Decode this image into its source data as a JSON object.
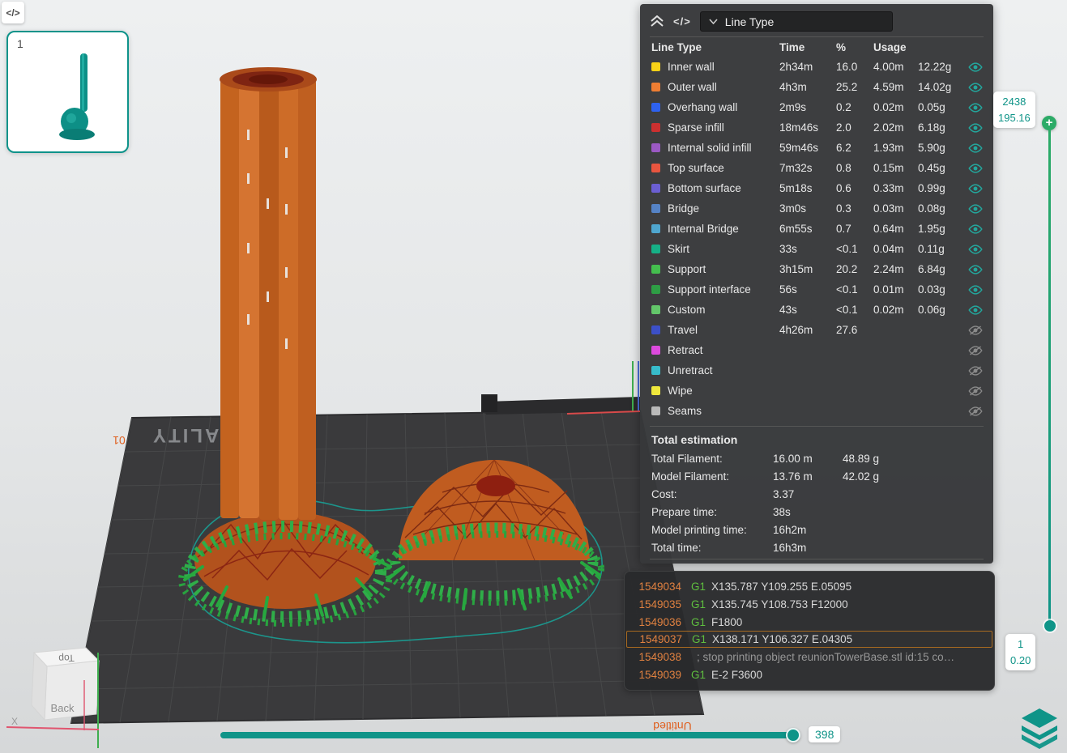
{
  "colors": {
    "accent": "#0F9488",
    "panel_bg": "#37383A",
    "highlight_border": "#A86A20"
  },
  "icons": {
    "code": "</>",
    "plus": "+"
  },
  "viewport": {
    "plate_brand": "CREALITY",
    "plate_corner_label": "01",
    "plate_name": "Untitled",
    "thumbnail_label": "1",
    "cube_top_label": "Top",
    "cube_back_label": "Back",
    "axis_x_label": "X"
  },
  "panel": {
    "dropdown_value": "Line Type",
    "columns": [
      "Line Type",
      "Time",
      "%",
      "Usage"
    ],
    "rows": [
      {
        "label": "Inner wall",
        "color": "#F7D117",
        "time": "2h34m",
        "pct": "16.0",
        "len": "4.00m",
        "wt": "12.22g",
        "visible": true
      },
      {
        "label": "Outer wall",
        "color": "#EE7D32",
        "time": "4h3m",
        "pct": "25.2",
        "len": "4.59m",
        "wt": "14.02g",
        "visible": true
      },
      {
        "label": "Overhang wall",
        "color": "#2E62F0",
        "time": "2m9s",
        "pct": "0.2",
        "len": "0.02m",
        "wt": "0.05g",
        "visible": true
      },
      {
        "label": "Sparse infill",
        "color": "#CB3030",
        "time": "18m46s",
        "pct": "2.0",
        "len": "2.02m",
        "wt": "6.18g",
        "visible": true
      },
      {
        "label": "Internal solid infill",
        "color": "#9B59C4",
        "time": "59m46s",
        "pct": "6.2",
        "len": "1.93m",
        "wt": "5.90g",
        "visible": true
      },
      {
        "label": "Top surface",
        "color": "#E8553F",
        "time": "7m32s",
        "pct": "0.8",
        "len": "0.15m",
        "wt": "0.45g",
        "visible": true
      },
      {
        "label": "Bottom surface",
        "color": "#6B5FD3",
        "time": "5m18s",
        "pct": "0.6",
        "len": "0.33m",
        "wt": "0.99g",
        "visible": true
      },
      {
        "label": "Bridge",
        "color": "#5583C6",
        "time": "3m0s",
        "pct": "0.3",
        "len": "0.03m",
        "wt": "0.08g",
        "visible": true
      },
      {
        "label": "Internal Bridge",
        "color": "#4FA6CF",
        "time": "6m55s",
        "pct": "0.7",
        "len": "0.64m",
        "wt": "1.95g",
        "visible": true
      },
      {
        "label": "Skirt",
        "color": "#16B087",
        "time": "33s",
        "pct": "<0.1",
        "len": "0.04m",
        "wt": "0.11g",
        "visible": true
      },
      {
        "label": "Support",
        "color": "#44BE4E",
        "time": "3h15m",
        "pct": "20.2",
        "len": "2.24m",
        "wt": "6.84g",
        "visible": true
      },
      {
        "label": "Support interface",
        "color": "#2E9E45",
        "time": "56s",
        "pct": "<0.1",
        "len": "0.01m",
        "wt": "0.03g",
        "visible": true
      },
      {
        "label": "Custom",
        "color": "#63C76A",
        "time": "43s",
        "pct": "<0.1",
        "len": "0.02m",
        "wt": "0.06g",
        "visible": true
      },
      {
        "label": "Travel",
        "color": "#3C50C8",
        "time": "4h26m",
        "pct": "27.6",
        "len": "",
        "wt": "",
        "visible": false
      },
      {
        "label": "Retract",
        "color": "#DD4ADD",
        "time": "",
        "pct": "",
        "len": "",
        "wt": "",
        "visible": false
      },
      {
        "label": "Unretract",
        "color": "#37BCCB",
        "time": "",
        "pct": "",
        "len": "",
        "wt": "",
        "visible": false
      },
      {
        "label": "Wipe",
        "color": "#EFE83C",
        "time": "",
        "pct": "",
        "len": "",
        "wt": "",
        "visible": false
      },
      {
        "label": "Seams",
        "color": "#B9B9B9",
        "time": "",
        "pct": "",
        "len": "",
        "wt": "",
        "visible": false
      }
    ],
    "total_title": "Total estimation",
    "totals": [
      {
        "label": "Total Filament:",
        "v1": "16.00 m",
        "v2": "48.89 g"
      },
      {
        "label": "Model Filament:",
        "v1": "13.76 m",
        "v2": "42.02 g"
      },
      {
        "label": "Cost:",
        "v1": "3.37",
        "v2": ""
      },
      {
        "label": "Prepare time:",
        "v1": "38s",
        "v2": ""
      },
      {
        "label": "Model printing time:",
        "v1": "16h2m",
        "v2": ""
      },
      {
        "label": "Total time:",
        "v1": "16h3m",
        "v2": ""
      }
    ]
  },
  "gcode": {
    "lines": [
      {
        "num": "1549034",
        "cmd": "G1",
        "args": "X135.787 Y109.255 E.05095",
        "comment": false,
        "active": false
      },
      {
        "num": "1549035",
        "cmd": "G1",
        "args": "X135.745 Y108.753 F12000",
        "comment": false,
        "active": false
      },
      {
        "num": "1549036",
        "cmd": "G1",
        "args": "F1800",
        "comment": false,
        "active": false
      },
      {
        "num": "1549037",
        "cmd": "G1",
        "args": "X138.171 Y106.327 E.04305",
        "comment": false,
        "active": true
      },
      {
        "num": "1549038",
        "cmd": "",
        "args": "; stop printing object reunionTowerBase.stl id:15 co…",
        "comment": true,
        "active": false
      },
      {
        "num": "1549039",
        "cmd": "G1",
        "args": "E-2 F3600",
        "comment": false,
        "active": false
      }
    ]
  },
  "layer_slider": {
    "top_layer": "2438",
    "top_height": "195.16",
    "bottom_layer": "1",
    "bottom_height": "0.20"
  },
  "move_slider": {
    "value": "398"
  }
}
